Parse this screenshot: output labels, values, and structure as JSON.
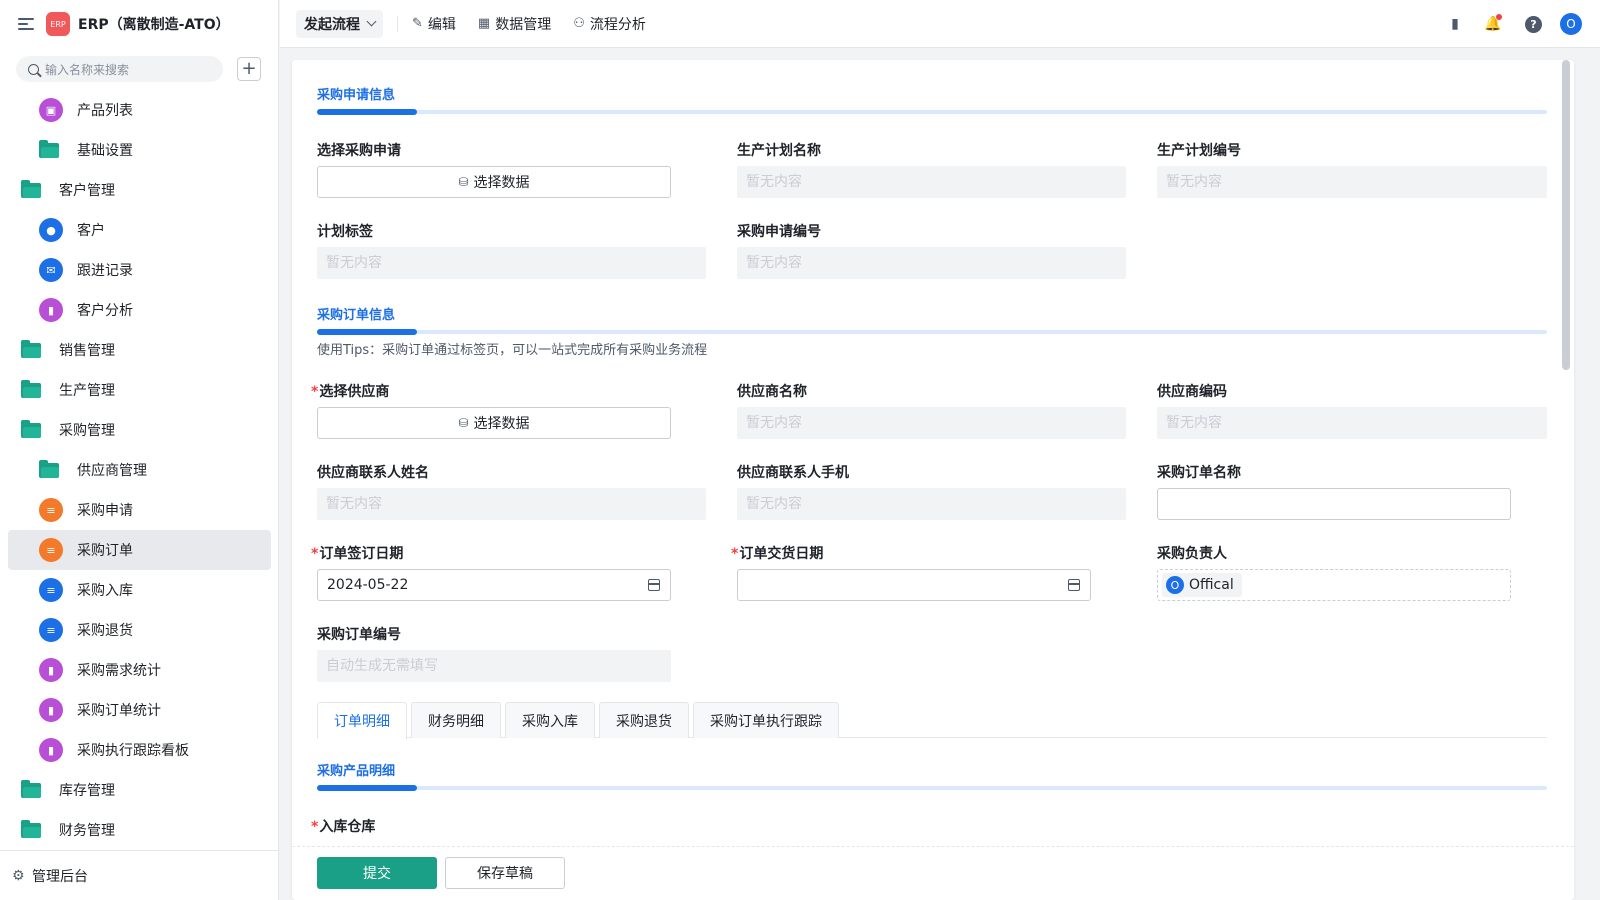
{
  "app": {
    "title": "ERP（离散制造-ATO）",
    "logo_text": "ERP"
  },
  "sidebar": {
    "search_placeholder": "输入名称来搜索",
    "items": [
      {
        "label": "产品列表",
        "level": 2,
        "icon": "chart-icon",
        "color": "#b84fd6"
      },
      {
        "label": "基础设置",
        "level": 2,
        "icon": "folder-icon",
        "color": "#1aa086"
      },
      {
        "label": "客户管理",
        "level": 1,
        "icon": "folder-icon",
        "color": "#1aa086"
      },
      {
        "label": "客户",
        "level": 2,
        "icon": "user-icon",
        "color": "#1d6fe6"
      },
      {
        "label": "跟进记录",
        "level": 2,
        "icon": "mail-icon",
        "color": "#1d6fe6"
      },
      {
        "label": "客户分析",
        "level": 2,
        "icon": "bar-chart-icon",
        "color": "#b84fd6"
      },
      {
        "label": "销售管理",
        "level": 1,
        "icon": "folder-icon",
        "color": "#1aa086"
      },
      {
        "label": "生产管理",
        "level": 1,
        "icon": "folder-icon",
        "color": "#1aa086"
      },
      {
        "label": "采购管理",
        "level": 1,
        "icon": "folder-icon",
        "color": "#1aa086"
      },
      {
        "label": "供应商管理",
        "level": 2,
        "icon": "folder-icon",
        "color": "#1aa086"
      },
      {
        "label": "采购申请",
        "level": 2,
        "icon": "doc-icon",
        "color": "#f27a2a"
      },
      {
        "label": "采购订单",
        "level": 2,
        "icon": "doc-icon",
        "color": "#f27a2a",
        "active": true
      },
      {
        "label": "采购入库",
        "level": 2,
        "icon": "doc-icon",
        "color": "#1d6fe6"
      },
      {
        "label": "采购退货",
        "level": 2,
        "icon": "doc-icon",
        "color": "#1d6fe6"
      },
      {
        "label": "采购需求统计",
        "level": 2,
        "icon": "bar-chart-icon",
        "color": "#b84fd6"
      },
      {
        "label": "采购订单统计",
        "level": 2,
        "icon": "bar-chart-icon",
        "color": "#b84fd6"
      },
      {
        "label": "采购执行跟踪看板",
        "level": 2,
        "icon": "bar-chart-icon",
        "color": "#b84fd6"
      },
      {
        "label": "库存管理",
        "level": 1,
        "icon": "folder-icon",
        "color": "#1aa086"
      },
      {
        "label": "财务管理",
        "level": 1,
        "icon": "folder-icon",
        "color": "#1aa086"
      }
    ],
    "footer_label": "管理后台"
  },
  "topbar": {
    "launch_label": "发起流程",
    "edit_label": "编辑",
    "data_mgmt_label": "数据管理",
    "flow_analysis_label": "流程分析",
    "avatar_initial": "O"
  },
  "form": {
    "section1": {
      "title": "采购申请信息",
      "select_request_label": "选择采购申请",
      "select_data_label": "选择数据",
      "plan_name_label": "生产计划名称",
      "plan_no_label": "生产计划编号",
      "plan_tag_label": "计划标签",
      "request_no_label": "采购申请编号",
      "empty_text": "暂无内容"
    },
    "section2": {
      "title": "采购订单信息",
      "tips": "使用Tips：采购订单通过标签页，可以一站式完成所有采购业务流程",
      "supplier_label": "选择供应商",
      "supplier_name_label": "供应商名称",
      "supplier_code_label": "供应商编码",
      "contact_name_label": "供应商联系人姓名",
      "contact_phone_label": "供应商联系人手机",
      "order_name_label": "采购订单名称",
      "order_name_value": "",
      "sign_date_label": "订单签订日期",
      "sign_date_value": "2024-05-22",
      "delivery_date_label": "订单交货日期",
      "delivery_date_value": "",
      "owner_label": "采购负责人",
      "owner_name": "Offical",
      "owner_initial": "O",
      "order_no_label": "采购订单编号",
      "order_no_placeholder": "自动生成无需填写"
    },
    "tabs": [
      {
        "label": "订单明细",
        "active": true
      },
      {
        "label": "财务明细"
      },
      {
        "label": "采购入库"
      },
      {
        "label": "采购退货"
      },
      {
        "label": "采购订单执行跟踪"
      }
    ],
    "section3": {
      "title": "采购产品明细",
      "warehouse_label": "入库仓库"
    },
    "submit_label": "提交",
    "draft_label": "保存草稿"
  },
  "colors": {
    "primary": "#1d6fe6",
    "submit": "#1aa086",
    "required": "#f53f3f"
  }
}
